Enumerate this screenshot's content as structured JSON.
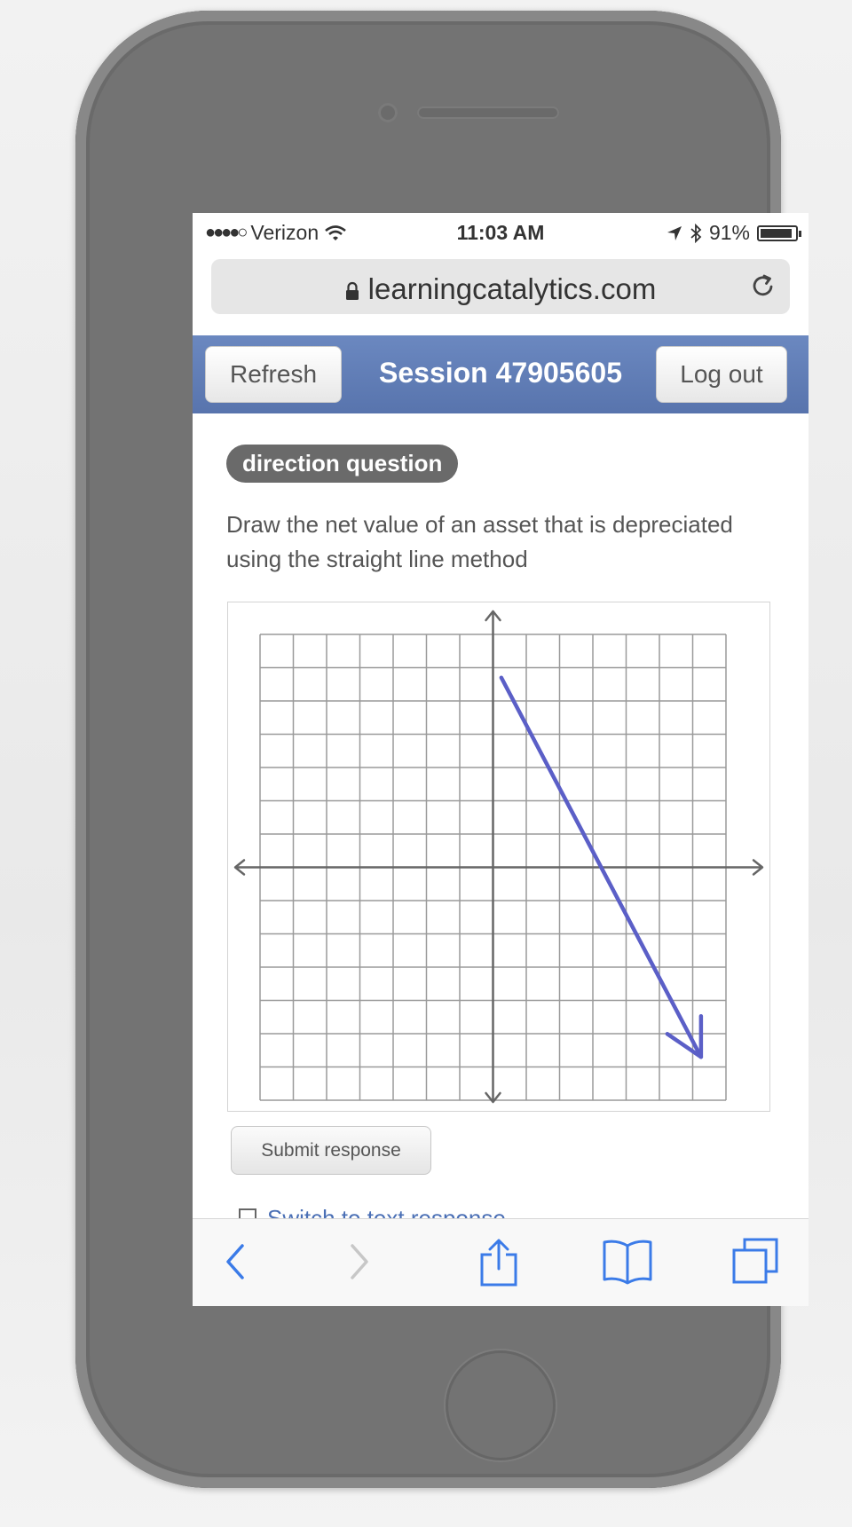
{
  "status_bar": {
    "signal": "●●●●○",
    "carrier": "Verizon",
    "time": "11:03 AM",
    "battery": "91%",
    "battery_level": 0.91
  },
  "browser": {
    "url": "learningcatalytics.com"
  },
  "header": {
    "refresh_label": "Refresh",
    "session_title": "Session 47905605",
    "logout_label": "Log out"
  },
  "question": {
    "badge": "direction question",
    "prompt": "Draw the net value of an asset that is depreciated using the straight line method"
  },
  "graph": {
    "grid_range": [
      -7,
      7
    ],
    "drawn_arrow": {
      "start": [
        0.25,
        5.7
      ],
      "end": [
        6.25,
        -5.7
      ]
    },
    "arrow_color": "#5b5fc7"
  },
  "submit_label": "Submit response",
  "partial_link": "Switch to text response",
  "toolbar_icons": [
    "back-icon",
    "forward-icon",
    "share-icon",
    "bookmarks-icon",
    "tabs-icon"
  ],
  "colors": {
    "header": "#5f7cb5",
    "link": "#4a6fb5",
    "badge": "#6a6a6a"
  }
}
